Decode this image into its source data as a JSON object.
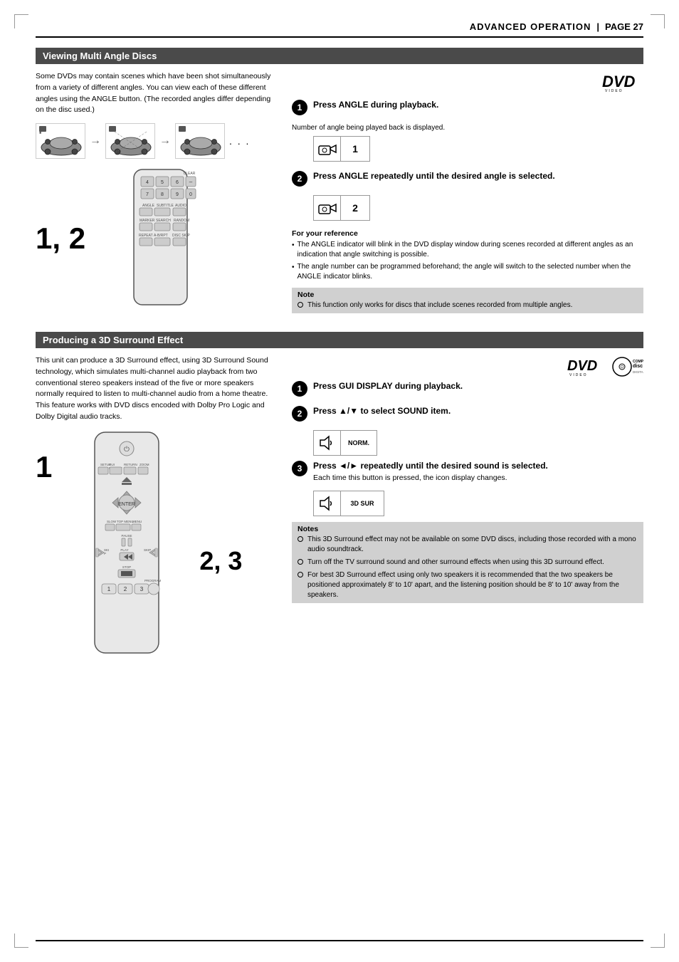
{
  "header": {
    "title": "ADVANCED OPERATION",
    "pipe": "|",
    "page": "PAGE 27"
  },
  "section1": {
    "title": "Viewing Multi Angle Discs",
    "body": "Some DVDs may contain scenes which have been shot simultaneously from a variety of different angles. You can view each of these different angles using the ANGLE button. (The recorded angles differ depending on the disc used.)",
    "steps": [
      {
        "number": "1",
        "text": "Press ANGLE during playback."
      },
      {
        "number": "2",
        "text": "Press ANGLE repeatedly until the desired angle is selected."
      }
    ],
    "angle_label": "Number of angle being played back is displayed.",
    "angle_display_1": "1",
    "angle_display_2": "2",
    "reference_title": "For your reference",
    "reference_items": [
      "The ANGLE indicator will blink in the DVD display window during scenes recorded at different angles as an indication that angle switching is possible.",
      "The angle number can be programmed beforehand; the angle will switch to the selected number when the ANGLE indicator blinks."
    ],
    "note_title": "Note",
    "note_items": [
      "This function only works for discs that include scenes recorded from multiple angles."
    ],
    "remote_label": "1, 2"
  },
  "section2": {
    "title": "Producing a 3D Surround Effect",
    "body": "This unit can produce a 3D Surround effect, using 3D Surround Sound technology, which simulates multi-channel audio playback from two conventional stereo speakers instead of the five or more speakers normally required to listen to multi-channel audio from a home theatre. This feature works with DVD discs encoded with Dolby Pro Logic and Dolby Digital audio tracks.",
    "steps": [
      {
        "number": "1",
        "text": "Press GUI DISPLAY during playback."
      },
      {
        "number": "2",
        "text": "Press ▲/▼ to select SOUND item."
      },
      {
        "number": "3",
        "text": "Press ◄/► repeatedly until the desired sound is selected.",
        "sub": "Each time this button is pressed, the icon display changes."
      }
    ],
    "norm_display": "NORM.",
    "sur3d_display": "3D SUR",
    "remote_label": "1",
    "remote_label2": "2, 3",
    "notes_title": "Notes",
    "note_items": [
      "This 3D Surround effect may not be available on some DVD discs, including those recorded with a mono audio soundtrack.",
      "Turn off the TV surround sound and other surround effects when using this 3D surround effect.",
      "For best 3D Surround effect using only two speakers it is recommended that the two speakers be positioned approximately 8' to 10' apart, and the listening position should be 8' to 10'  away from the speakers."
    ]
  }
}
